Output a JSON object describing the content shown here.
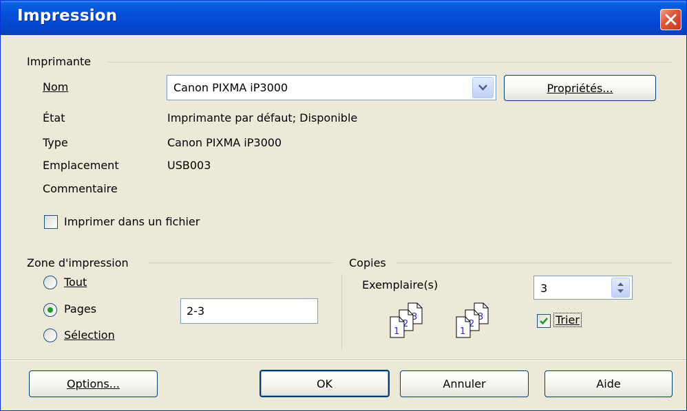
{
  "window": {
    "title": "Impression",
    "close_icon": "close-icon"
  },
  "printer": {
    "group_label": "Imprimante",
    "name_label": "Nom",
    "name_value": "Canon PIXMA iP3000",
    "properties_button": "Propriétés...",
    "status_label": "État",
    "status_value": "Imprimante par défaut; Disponible",
    "type_label": "Type",
    "type_value": "Canon PIXMA iP3000",
    "location_label": "Emplacement",
    "location_value": "USB003",
    "comment_label": "Commentaire",
    "print_to_file_label": "Imprimer dans un fichier",
    "print_to_file_checked": false
  },
  "print_range": {
    "group_label": "Zone d'impression",
    "all_label": "Tout",
    "pages_label": "Pages",
    "selection_label": "Sélection",
    "selected": "pages",
    "pages_value": "2-3"
  },
  "copies": {
    "group_label": "Copies",
    "count_label": "Exemplaire(s)",
    "count_value": "3",
    "collate_label": "Trier",
    "collate_checked": true,
    "collate_icon_pages": [
      "1",
      "2",
      "3"
    ]
  },
  "buttons": {
    "options": "Options...",
    "ok": "OK",
    "cancel": "Annuler",
    "help": "Aide"
  },
  "colors": {
    "titlebar": "#0450d8",
    "dialog_bg": "#ece9d8",
    "field_border": "#7f9db9",
    "accent_check": "#1f9c25"
  }
}
